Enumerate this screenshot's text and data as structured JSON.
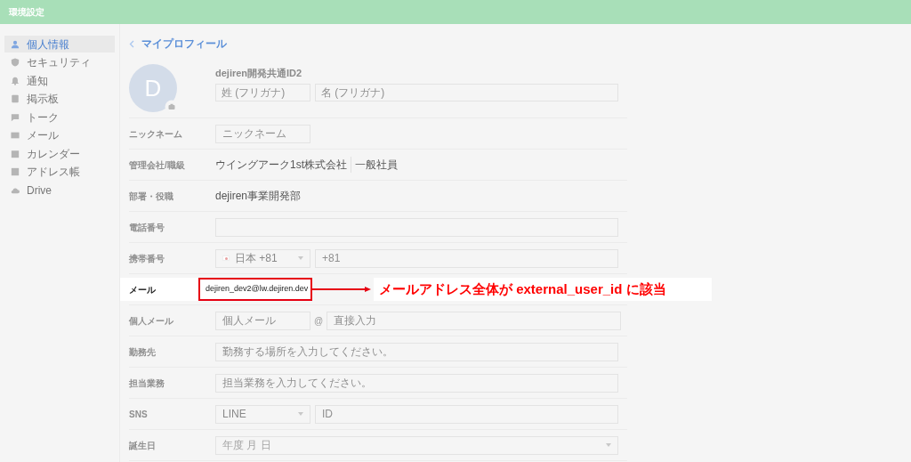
{
  "header": {
    "title": "環境設定"
  },
  "sidebar": {
    "items": [
      {
        "label": "個人情報",
        "selected": true
      },
      {
        "label": "セキュリティ",
        "selected": false
      },
      {
        "label": "通知",
        "selected": false
      },
      {
        "label": "掲示板",
        "selected": false
      },
      {
        "label": "トーク",
        "selected": false
      },
      {
        "label": "メール",
        "selected": false
      },
      {
        "label": "カレンダー",
        "selected": false
      },
      {
        "label": "アドレス帳",
        "selected": false
      },
      {
        "label": "Drive",
        "selected": false
      }
    ]
  },
  "profile": {
    "back_label": "マイプロフィール",
    "avatar_initial": "D",
    "display_name": "dejiren開発共通ID2",
    "last_kana": {
      "placeholder": "姓 (フリガナ)"
    },
    "first_kana": {
      "placeholder": "名 (フリガナ)"
    }
  },
  "rows": [
    {
      "kind": "short_input",
      "label": "ニックネーム",
      "placeholder": "ニックネーム"
    },
    {
      "kind": "text",
      "label": "管理会社/職級",
      "value": "ウイングアーク1st株式会社",
      "value_2": "一般社員"
    },
    {
      "kind": "text",
      "label": "部署・役職",
      "value": "dejiren事業開発部"
    },
    {
      "kind": "input",
      "label": "電話番号"
    },
    {
      "kind": "phone",
      "label": "携帯番号",
      "select": "日本 +81",
      "placeholder": "+81"
    },
    {
      "kind": "highlight",
      "label": "メール",
      "value": "dejiren_dev2@lw.dejiren.dev",
      "callout": "メールアドレス全体が external_user_id に該当"
    },
    {
      "kind": "split_email",
      "label": "個人メール",
      "placeholder": "個人メール",
      "separator": "@",
      "placeholder_2": "直接入力"
    },
    {
      "kind": "input",
      "label": "勤務先",
      "placeholder": "勤務する場所を入力してください。"
    },
    {
      "kind": "input",
      "label": "担当業務",
      "placeholder": "担当業務を入力してください。"
    },
    {
      "kind": "phone",
      "label": "SNS",
      "select": "LINE",
      "placeholder": "ID"
    },
    {
      "kind": "select",
      "label": "誕生日",
      "placeholder": "年度 月 日"
    }
  ]
}
